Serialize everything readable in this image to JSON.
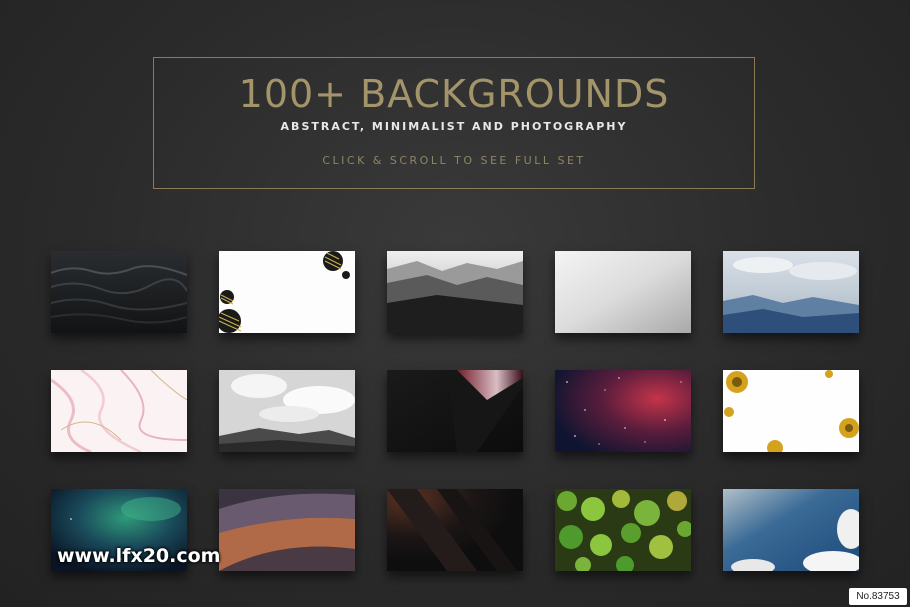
{
  "header": {
    "headline": "100+ BACKGROUNDS",
    "subhead": "ABSTRACT, MINIMALIST AND PHOTOGRAPHY",
    "cta": "CLICK & SCROLL TO SEE FULL SET"
  },
  "thumbnails": [
    {
      "name": "dark-ocean-waves"
    },
    {
      "name": "white-golden-spheres"
    },
    {
      "name": "misty-mountains-bw"
    },
    {
      "name": "silver-gradient"
    },
    {
      "name": "mountain-sky-blue"
    },
    {
      "name": "pink-marble"
    },
    {
      "name": "clouds-hills-bw"
    },
    {
      "name": "dark-red-light-streak"
    },
    {
      "name": "red-galaxy"
    },
    {
      "name": "golden-dandelions"
    },
    {
      "name": "green-nebula"
    },
    {
      "name": "volcanic-hills"
    },
    {
      "name": "dark-orange-diagonals"
    },
    {
      "name": "green-bubbles"
    },
    {
      "name": "blue-sky-clouds"
    }
  ],
  "watermark": "www.lfx20.com",
  "badge": "No.83753"
}
